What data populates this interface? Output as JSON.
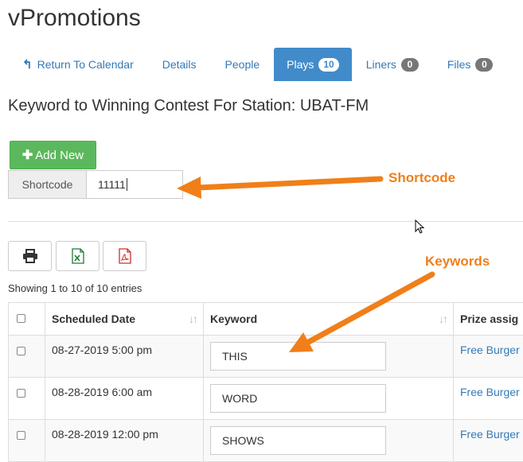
{
  "app": {
    "title": "vPromotions"
  },
  "tabs": [
    {
      "label": "Return To Calendar",
      "icon": "back-arrow-icon"
    },
    {
      "label": "Details"
    },
    {
      "label": "People"
    },
    {
      "label": "Plays",
      "badge": "10",
      "active": true
    },
    {
      "label": "Liners",
      "badge": "0"
    },
    {
      "label": "Files",
      "badge": "0"
    }
  ],
  "page": {
    "heading": "Keyword to Winning Contest For Station: UBAT-FM"
  },
  "actions": {
    "add_new_label": "Add New"
  },
  "shortcode": {
    "label": "Shortcode",
    "value": "11111"
  },
  "exports": {
    "print_icon": "print-icon",
    "excel_icon": "excel-icon",
    "pdf_icon": "pdf-icon"
  },
  "table": {
    "info": "Showing 1 to 10 of 10 entries",
    "columns": [
      "",
      "Scheduled Date",
      "Keyword",
      "Prize assig"
    ],
    "rows": [
      {
        "date": "08-27-2019 5:00 pm",
        "keyword": "THIS",
        "prize": "Free Burger"
      },
      {
        "date": "08-28-2019 6:00 am",
        "keyword": "WORD",
        "prize": "Free Burger"
      },
      {
        "date": "08-28-2019 12:00 pm",
        "keyword": "SHOWS",
        "prize": "Free Burger"
      }
    ]
  },
  "annotations": {
    "shortcode_label": "Shortcode",
    "keywords_label": "Keywords",
    "arrow_color": "#f07f19"
  },
  "colors": {
    "primary": "#428bca",
    "success": "#5cb85c",
    "link": "#337ab7",
    "badge": "#777777"
  }
}
